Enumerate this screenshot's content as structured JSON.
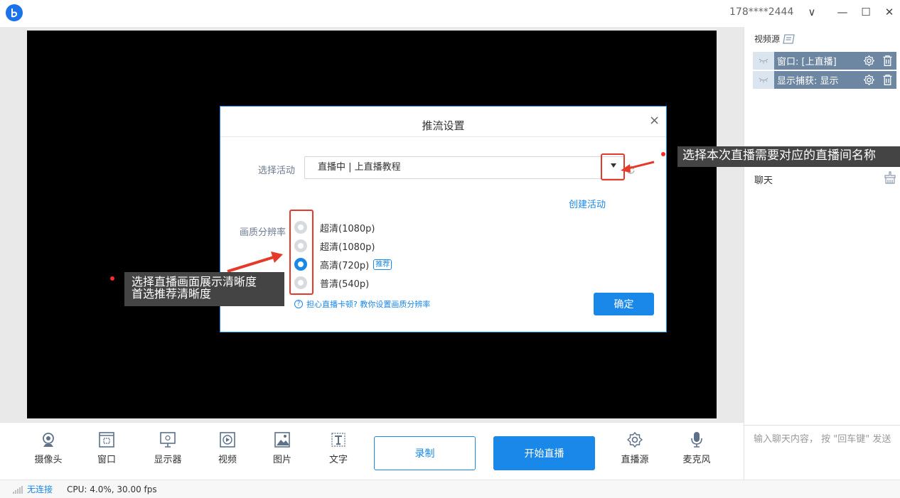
{
  "titlebar": {
    "account": "178****2444",
    "chevron": "∨",
    "minimize": "—",
    "maximize": "☐",
    "close": "✕"
  },
  "sources": {
    "title": "视频源",
    "items": [
      {
        "name": "窗口: [上直播]"
      },
      {
        "name": "显示捕获: 显示"
      }
    ]
  },
  "chat": {
    "title": "聊天",
    "placeholder": "输入聊天内容， 按 \"回车键\" 发送"
  },
  "toolbar": {
    "camera": "摄像头",
    "window": "窗口",
    "display": "显示器",
    "video": "视频",
    "image": "图片",
    "text": "文字",
    "record": "录制",
    "start_live": "开始直播",
    "live_source": "直播源",
    "mic": "麦克风"
  },
  "status": {
    "connection": "无连接",
    "cpu": "CPU: 4.0%,  30.00 fps"
  },
  "dialog": {
    "title": "推流设置",
    "close": "×",
    "activity_label": "选择活动",
    "activity_value": "直播中 | 上直播教程",
    "create_activity": "创建活动",
    "quality_label": "画质分辨率",
    "options": [
      {
        "label": "超清(1080p)",
        "selected": false
      },
      {
        "label": "超清(1080p)",
        "selected": false
      },
      {
        "label": "高清(720p)",
        "selected": true,
        "badge": "推荐"
      },
      {
        "label": "普清(540p)",
        "selected": false
      }
    ],
    "help": "担心直播卡顿? 教你设置画质分辨率",
    "confirm": "确定"
  },
  "annotations": {
    "right": "选择本次直播需要对应的直播间名称",
    "left_line1": "选择直播画面展示清晰度",
    "left_line2": "首选推荐清晰度"
  },
  "colors": {
    "accent": "#1a88e8",
    "annotation_red": "#e53a2a",
    "source_item": "#6d87a3"
  }
}
